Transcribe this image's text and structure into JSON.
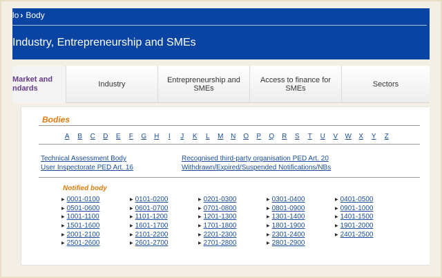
{
  "breadcrumb": {
    "prev": "lo",
    "current": "Body"
  },
  "header": {
    "title": "Industry, Entrepreneurship and SMEs"
  },
  "tabs": [
    {
      "label": "Market and\nndards"
    },
    {
      "label": "Industry"
    },
    {
      "label": "Entrepreneurship and SMEs"
    },
    {
      "label": "Access to finance for SMEs"
    },
    {
      "label": "Sectors"
    }
  ],
  "content": {
    "title": "Bodies",
    "alphabet": [
      "A",
      "B",
      "C",
      "D",
      "E",
      "F",
      "G",
      "H",
      "I",
      "J",
      "K",
      "L",
      "M",
      "N",
      "O",
      "P",
      "Q",
      "R",
      "S",
      "T",
      "U",
      "V",
      "W",
      "X",
      "Y",
      "Z"
    ],
    "links_left": [
      "Technical Assessment Body",
      "User Inspectorate PED Art. 16"
    ],
    "links_right": [
      "Recognised third-party organisation PED Art. 20",
      "Withdrawn/Expired/Suspended Notifications/NBs"
    ],
    "notified_title": "Notified body",
    "ranges": [
      [
        "0001-0100",
        "0501-0600",
        "1001-1100",
        "1501-1600",
        "2001-2100",
        "2501-2600"
      ],
      [
        "0101-0200",
        "0601-0700",
        "1101-1200",
        "1601-1700",
        "2101-2200",
        "2601-2700"
      ],
      [
        "0201-0300",
        "0701-0800",
        "1201-1300",
        "1701-1800",
        "2201-2300",
        "2701-2800"
      ],
      [
        "0301-0400",
        "0801-0900",
        "1301-1400",
        "1801-1900",
        "2301-2400",
        "2801-2900"
      ],
      [
        "0401-0500",
        "0901-1000",
        "1401-1500",
        "1901-2000",
        "2401-2500"
      ]
    ]
  }
}
